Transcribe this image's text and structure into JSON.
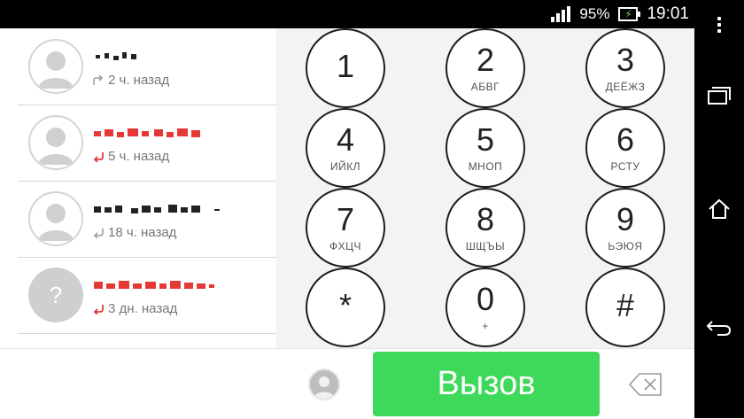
{
  "status_bar": {
    "battery_percent": "95%",
    "time": "19:01"
  },
  "call_log": [
    {
      "time_ago": "2 ч. назад",
      "call_type": "outgoing",
      "avatar": "person",
      "name_color": "#222222"
    },
    {
      "time_ago": "5 ч. назад",
      "call_type": "missed",
      "avatar": "person",
      "name_color": "#e53935"
    },
    {
      "time_ago": "18 ч. назад",
      "call_type": "incoming",
      "avatar": "person",
      "name_color": "#222222"
    },
    {
      "time_ago": "3 дн. назад",
      "call_type": "missed",
      "avatar": "unknown",
      "name_color": "#e53935"
    }
  ],
  "dialpad": {
    "keys": [
      {
        "digit": "1",
        "letters": ""
      },
      {
        "digit": "2",
        "letters": "АБВГ"
      },
      {
        "digit": "3",
        "letters": "ДЕЁЖЗ"
      },
      {
        "digit": "4",
        "letters": "ИЙКЛ"
      },
      {
        "digit": "5",
        "letters": "МНОП"
      },
      {
        "digit": "6",
        "letters": "РСТУ"
      },
      {
        "digit": "7",
        "letters": "ФХЦЧ"
      },
      {
        "digit": "8",
        "letters": "ШЩЪЫ"
      },
      {
        "digit": "9",
        "letters": "ЬЭЮЯ"
      },
      {
        "digit": "*",
        "letters": ""
      },
      {
        "digit": "0",
        "letters": "+"
      },
      {
        "digit": "#",
        "letters": ""
      }
    ]
  },
  "bottom_bar": {
    "call_label": "Вызов"
  },
  "colors": {
    "call_button": "#3ed95a",
    "missed_arrow": "#e53935",
    "received_arrow": "#9e9e9e"
  }
}
